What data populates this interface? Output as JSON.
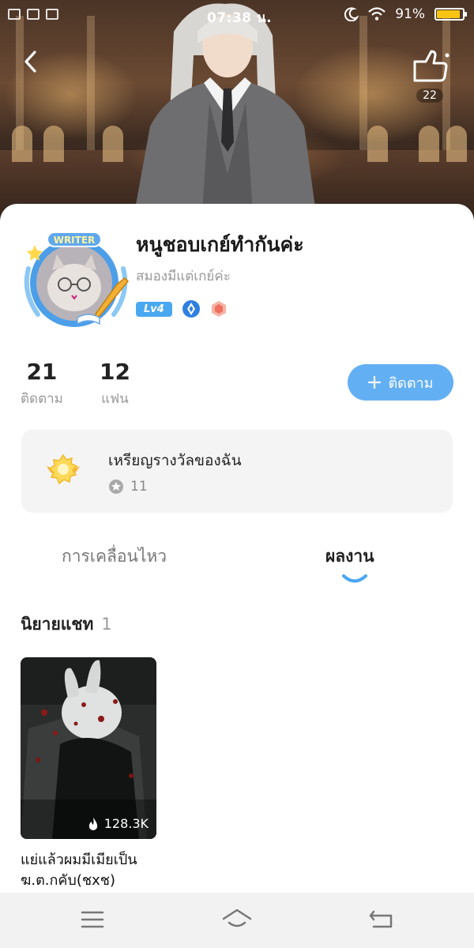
{
  "status_bar": {
    "time": "07:38 น.",
    "battery": "91%",
    "battery_level": 0.91,
    "icons": [
      "notification-icon",
      "mail-icon",
      "lock-icon",
      "moon-icon",
      "wifi-icon",
      "battery-icon"
    ]
  },
  "header": {
    "like_count": "22",
    "icons": [
      "back-arrow-icon",
      "like-hand-icon"
    ]
  },
  "profile": {
    "name": "หนูชอบเกย์ทำกันค่ะ",
    "bio": "สมองมีแต่เกย์ค่ะ",
    "avatar_badge": "WRITER",
    "level": "Lv4",
    "following_count": "21",
    "following_label": "ติดตาม",
    "fans_count": "12",
    "fans_label": "แฟน",
    "follow_button": "ติดตาม"
  },
  "medals": {
    "title": "เหรียญรางวัลของฉัน",
    "count": "11"
  },
  "tabs": [
    {
      "label": "การเคลื่อนไหว",
      "active": false
    },
    {
      "label": "ผลงาน",
      "active": true
    }
  ],
  "section": {
    "title": "นิยายแชท",
    "count": "1"
  },
  "novels": [
    {
      "title": "แย่แล้วผมมีเมียเป็นฆ.ต.กคับ(ชxช)",
      "views": "128.3K"
    }
  ],
  "colors": {
    "accent": "#63aff4",
    "level_badge": "#4aa8f0",
    "battery_fill": "#f8c414"
  },
  "navbar": {
    "icons": [
      "menu-icon",
      "home-icon",
      "back-icon"
    ]
  }
}
